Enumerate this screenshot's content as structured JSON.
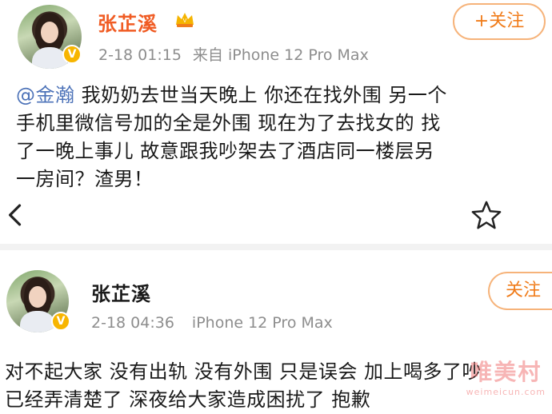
{
  "post1": {
    "author": "张芷溪",
    "verified_badge": "V",
    "vip_icon": "crown-icon",
    "date": "2-18 01:15",
    "source": "来自 iPhone 12 Pro Max",
    "follow_label": "+关注",
    "mention": "@金瀚",
    "text_lines": [
      "我奶奶去世当天晚上 你还在找外围 另一个",
      "手机里微信号加的全是外围 现在为了去找女的 找",
      "了一晚上事儿 故意跟我吵架去了酒店同一楼层另",
      "一房间？渣男！"
    ]
  },
  "toolbar": {
    "back_icon": "back-arrow-icon",
    "favorite_icon": "star-icon"
  },
  "post2": {
    "author": "张芷溪",
    "verified_badge": "V",
    "date": "2-18 04:36",
    "source": "iPhone 12 Pro Max",
    "follow_label": "关注",
    "text_lines": [
      "对不起大家 没有出轨 没有外围 只是误会 加上喝多了吵",
      "已经弄清楚了 深夜给大家造成困扰了 抱歉"
    ]
  },
  "watermark": {
    "cn": "唯美村",
    "en": "weimeicun.com"
  },
  "colors": {
    "vip_name": "#f05c24",
    "follow": "#f07c1a",
    "mention": "#4c72b8",
    "meta": "#8d8d8d"
  }
}
